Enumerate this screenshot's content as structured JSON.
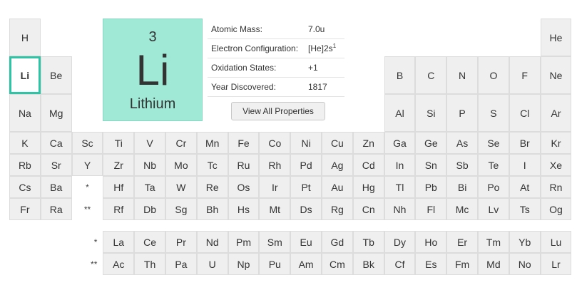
{
  "selected_element": {
    "atomic_number": "3",
    "symbol": "Li",
    "name": "Lithium",
    "tile_color": "#9fe9d6"
  },
  "properties": [
    {
      "label": "Atomic Mass:",
      "value": "7.0u",
      "sup": ""
    },
    {
      "label": "Electron Configuration:",
      "value": "[He]2s",
      "sup": "1"
    },
    {
      "label": "Oxidation States:",
      "value": "+1",
      "sup": ""
    },
    {
      "label": "Year Discovered:",
      "value": "1817",
      "sup": ""
    }
  ],
  "view_all_button": "View All Properties",
  "selection_color": "#2cc4a4",
  "main_rows": [
    [
      "H",
      "",
      "",
      "",
      "",
      "",
      "",
      "",
      "",
      "",
      "",
      "",
      "",
      "",
      "",
      "",
      "",
      "He"
    ],
    [
      "Li",
      "Be",
      "",
      "",
      "",
      "",
      "",
      "",
      "",
      "",
      "",
      "",
      "B",
      "C",
      "N",
      "O",
      "F",
      "Ne"
    ],
    [
      "Na",
      "Mg",
      "",
      "",
      "",
      "",
      "",
      "",
      "",
      "",
      "",
      "",
      "Al",
      "Si",
      "P",
      "S",
      "Cl",
      "Ar"
    ],
    [
      "K",
      "Ca",
      "Sc",
      "Ti",
      "V",
      "Cr",
      "Mn",
      "Fe",
      "Co",
      "Ni",
      "Cu",
      "Zn",
      "Ga",
      "Ge",
      "As",
      "Se",
      "Br",
      "Kr"
    ],
    [
      "Rb",
      "Sr",
      "Y",
      "Zr",
      "Nb",
      "Mo",
      "Tc",
      "Ru",
      "Rh",
      "Pd",
      "Ag",
      "Cd",
      "In",
      "Sn",
      "Sb",
      "Te",
      "I",
      "Xe"
    ],
    [
      "Cs",
      "Ba",
      "*",
      "Hf",
      "Ta",
      "W",
      "Re",
      "Os",
      "Ir",
      "Pt",
      "Au",
      "Hg",
      "Tl",
      "Pb",
      "Bi",
      "Po",
      "At",
      "Rn"
    ],
    [
      "Fr",
      "Ra",
      "**",
      "Rf",
      "Db",
      "Sg",
      "Bh",
      "Hs",
      "Mt",
      "Ds",
      "Rg",
      "Cn",
      "Nh",
      "Fl",
      "Mc",
      "Lv",
      "Ts",
      "Og"
    ]
  ],
  "lanthanides_marker": "*",
  "actinides_marker": "**",
  "lanthanides": [
    "La",
    "Ce",
    "Pr",
    "Nd",
    "Pm",
    "Sm",
    "Eu",
    "Gd",
    "Tb",
    "Dy",
    "Ho",
    "Er",
    "Tm",
    "Yb",
    "Lu"
  ],
  "actinides": [
    "Ac",
    "Th",
    "Pa",
    "U",
    "Np",
    "Pu",
    "Am",
    "Cm",
    "Bk",
    "Cf",
    "Es",
    "Fm",
    "Md",
    "No",
    "Lr"
  ]
}
